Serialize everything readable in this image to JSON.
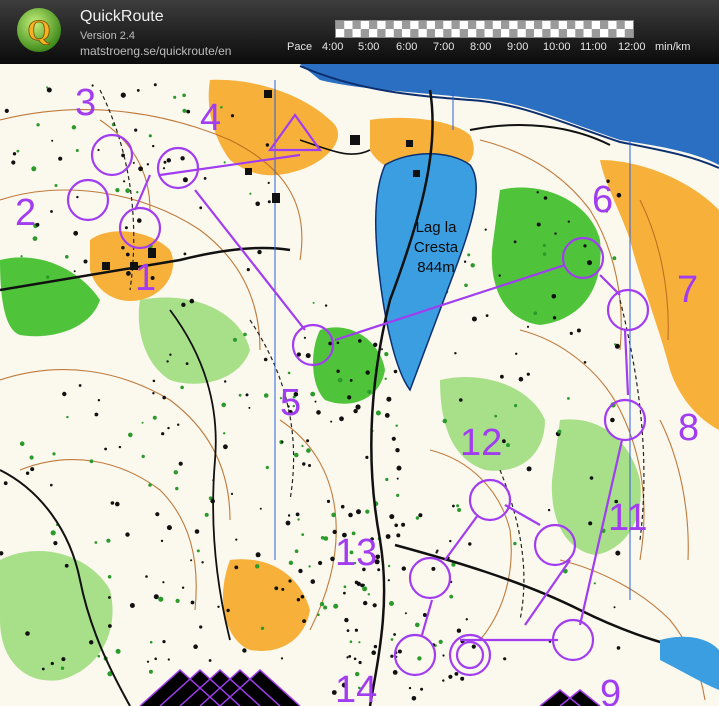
{
  "app": {
    "name": "QuickRoute",
    "version": "Version 2.4",
    "url": "matstroeng.se/quickroute/en"
  },
  "pace": {
    "label": "Pace",
    "ticks": [
      "4:00",
      "5:00",
      "6:00",
      "7:00",
      "8:00",
      "9:00",
      "10:00",
      "11:00",
      "12:00"
    ],
    "unit": "min/km"
  },
  "map": {
    "lake_name": "Lag la",
    "lake_name2": "Cresta",
    "lake_elevation": "844m",
    "controls": [
      "1",
      "2",
      "3",
      "4",
      "5",
      "6",
      "7",
      "8",
      "11",
      "12",
      "13",
      "14",
      "9"
    ],
    "course_color": "#a13cf0",
    "colors": {
      "open": "#f7b13a",
      "forest_green": "#4fc43a",
      "light_green": "#a8e08a",
      "water": "#3b9ee0",
      "sea": "#1e6fc9",
      "contour": "#b5651d",
      "road": "#111111"
    }
  }
}
